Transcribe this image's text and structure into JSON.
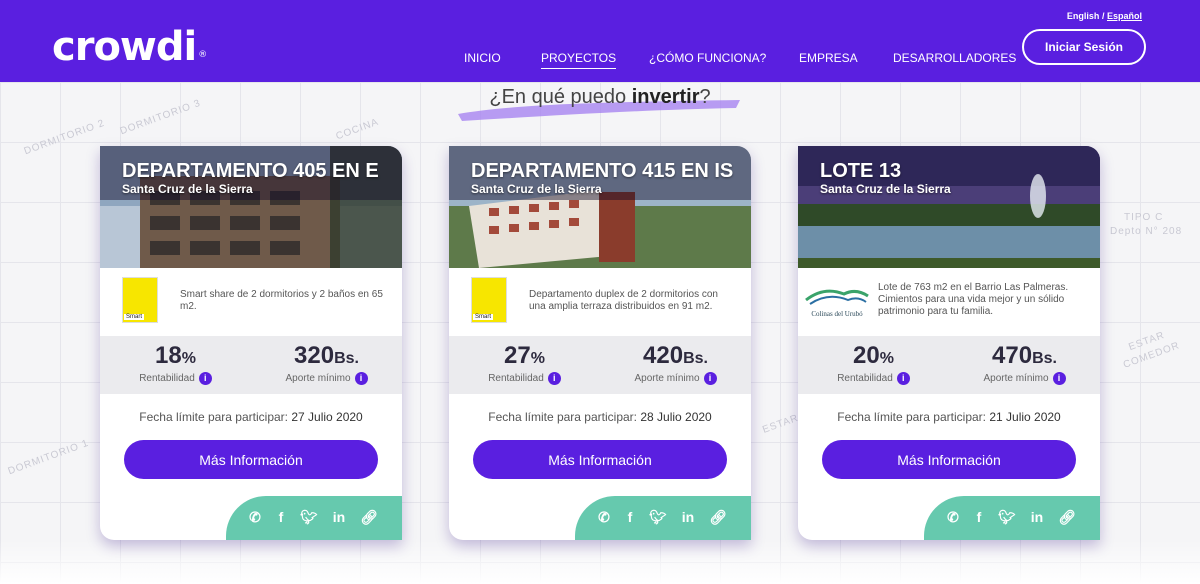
{
  "header": {
    "logo": "crowdi",
    "logo_mark": "®",
    "lang_en": "English",
    "lang_sep": "/",
    "lang_es": "Español",
    "nav": [
      "INICIO",
      "PROYECTOS",
      "¿CÓMO FUNCIONA?",
      "EMPRESA",
      "DESARROLLADORES"
    ],
    "login": "Iniciar Sesión"
  },
  "section": {
    "title_pre": "¿En qué puedo ",
    "title_bold": "invertir",
    "title_post": "?"
  },
  "background_labels": [
    "DORMITORIO 2",
    "DORMITORIO 3",
    "COCINA",
    "DORMITORIO 1",
    "TIPO C",
    "Depto N° 208",
    "ESTAR COMEDOR",
    "ESTAR",
    "COMEDOR"
  ],
  "cards": [
    {
      "title": "DEPARTAMENTO 405 EN E",
      "location": "Santa Cruz de la Sierra",
      "developer_logo": "Smart",
      "description": "Smart share de 2 dormitorios y 2 baños en 65 m2.",
      "yield_value": "18",
      "yield_unit": "%",
      "yield_label": "Rentabilidad",
      "min_value": "320",
      "min_unit": "Bs.",
      "min_label": "Aporte mínimo",
      "deadline_label": "Fecha límite para participar:",
      "deadline_date": "27 Julio 2020",
      "button": "Más Información"
    },
    {
      "title": "DEPARTAMENTO 415 EN IS",
      "location": "Santa Cruz de la Sierra",
      "developer_logo": "Smart",
      "description": "Departamento duplex de 2 dormitorios con una amplia terraza distribuidos en 91 m2.",
      "yield_value": "27",
      "yield_unit": "%",
      "yield_label": "Rentabilidad",
      "min_value": "420",
      "min_unit": "Bs.",
      "min_label": "Aporte mínimo",
      "deadline_label": "Fecha límite para participar:",
      "deadline_date": "28 Julio 2020",
      "button": "Más Información"
    },
    {
      "title": "LOTE 13",
      "location": "Santa Cruz de la Sierra",
      "developer_logo": "Colinas del Urubó",
      "description": "Lote de 763 m2 en el Barrio Las Palmeras. Cimientos para una vida mejor y un sólido patrimonio para tu familia.",
      "yield_value": "20",
      "yield_unit": "%",
      "yield_label": "Rentabilidad",
      "min_value": "470",
      "min_unit": "Bs.",
      "min_label": "Aporte mínimo",
      "deadline_label": "Fecha límite para participar:",
      "deadline_date": "21 Julio 2020",
      "button": "Más Información"
    }
  ],
  "share_icons": [
    "whatsapp-icon",
    "facebook-icon",
    "twitter-icon",
    "linkedin-icon",
    "link-icon"
  ],
  "colors": {
    "brand": "#5a1fe0",
    "share": "#66c9ae",
    "stats_bg": "#ebebee"
  }
}
